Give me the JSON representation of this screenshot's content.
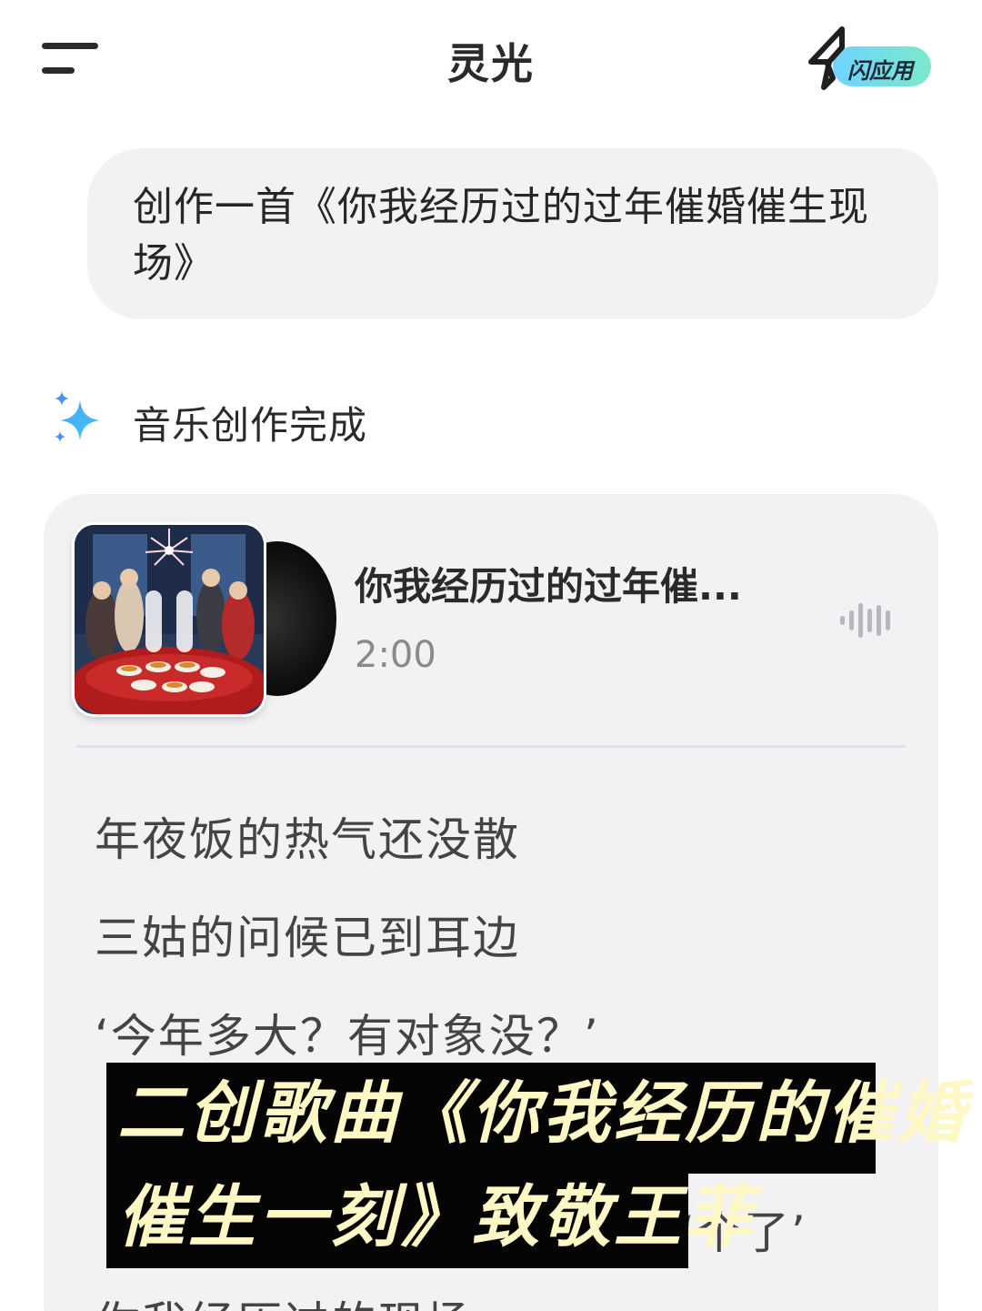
{
  "header": {
    "title": "灵光",
    "flash_app_label": "闪应用"
  },
  "prompt": {
    "text": "创作一首《你我经历过的过年催婚催生现场》"
  },
  "status": {
    "text": "音乐创作完成"
  },
  "music_card": {
    "song_title": "你我经历过的过年催...",
    "duration": "2:00",
    "lyrics": [
      "年夜饭的热气还没散",
      "三姑的问候已到耳边",
      "‘今年多大？有对象没？’",
      "",
      "‘个了’",
      "你我经历过的现场"
    ]
  },
  "caption": {
    "line1": "二创歌曲《你我经历的催婚",
    "line2": "催生一刻》致敬王菲"
  },
  "colors": {
    "accent_gradient_start": "#6fd3ff",
    "accent_gradient_end": "#7ae9c9",
    "caption_text": "#fff7c4",
    "caption_bg": "#050505"
  }
}
